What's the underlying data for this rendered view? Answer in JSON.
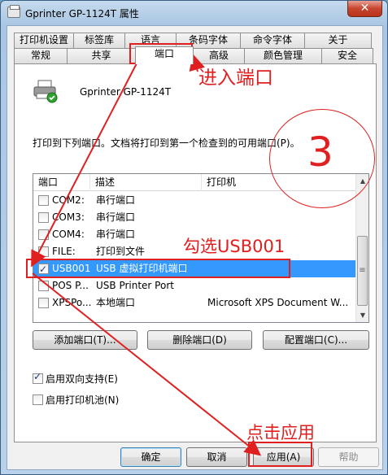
{
  "window": {
    "title": "Gprinter  GP-1124T 属性",
    "close_glyph": "✕"
  },
  "tabs": {
    "row1": [
      "打印机设置",
      "标签库",
      "语言",
      "条码字体",
      "命令字体",
      "关于"
    ],
    "row2": [
      "常规",
      "共享",
      "端口",
      "高级",
      "颜色管理",
      "安全"
    ],
    "active": "端口"
  },
  "printer": {
    "name": "Gprinter  GP-1124T"
  },
  "description": "打印到下列端口。文档将打印到第一个检查到的可用端口(P)。",
  "ports": {
    "columns": [
      "端口",
      "描述",
      "打印机"
    ],
    "rows": [
      {
        "port": "COM2:",
        "description": "串行端口",
        "printer": "",
        "checked": false,
        "selected": false
      },
      {
        "port": "COM3:",
        "description": "串行端口",
        "printer": "",
        "checked": false,
        "selected": false
      },
      {
        "port": "COM4:",
        "description": "串行端口",
        "printer": "",
        "checked": false,
        "selected": false
      },
      {
        "port": "FILE:",
        "description": "打印到文件",
        "printer": "",
        "checked": false,
        "selected": false
      },
      {
        "port": "USB001",
        "description": "USB 虚拟打印机端口",
        "printer": "",
        "checked": true,
        "selected": true
      },
      {
        "port": "POS P...",
        "description": "USB Printer Port",
        "printer": "",
        "checked": false,
        "selected": false
      },
      {
        "port": "XPSPo...",
        "description": "本地端口",
        "printer": "Microsoft XPS Document W...",
        "checked": false,
        "selected": false
      }
    ]
  },
  "port_buttons": {
    "add": "添加端口(T)...",
    "delete": "删除端口(D)",
    "configure": "配置端口(C)..."
  },
  "options": {
    "bidirectional": {
      "label": "启用双向支持(E)",
      "checked": true
    },
    "pooling": {
      "label": "启用打印机池(N)",
      "checked": false
    }
  },
  "dialog_buttons": {
    "ok": "确定",
    "cancel": "取消",
    "apply": "应用(A)",
    "help": "帮助"
  },
  "annotations": {
    "enter_port": "进入端口",
    "check_usb": "勾选USB001",
    "click_apply": "点击应用",
    "step": "3",
    "color": "#e02020"
  }
}
